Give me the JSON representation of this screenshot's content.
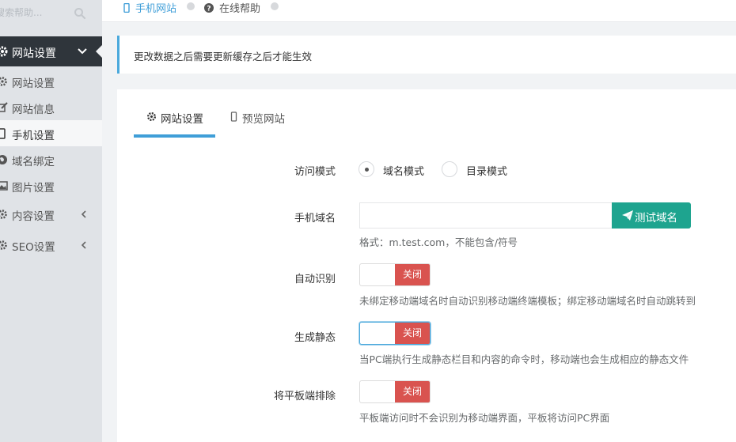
{
  "sidebar": {
    "search_placeholder": "搜索帮助...",
    "group_label": "网站设置",
    "items": [
      {
        "label": "网站设置",
        "icon": "gear-icon"
      },
      {
        "label": "网站信息",
        "icon": "edit-icon"
      },
      {
        "label": "手机设置",
        "icon": "mobile-icon"
      },
      {
        "label": "域名绑定",
        "icon": "globe-icon"
      },
      {
        "label": "图片设置",
        "icon": "image-icon"
      },
      {
        "label": "内容设置",
        "icon": "gear-icon"
      },
      {
        "label": "SEO设置",
        "icon": "gear-icon"
      }
    ]
  },
  "breadcrumb": [
    {
      "label": "手机网站",
      "icon": "mobile-icon"
    },
    {
      "label": "在线帮助",
      "icon": "help-icon"
    }
  ],
  "alert": {
    "text": "更改数据之后需要更新缓存之后才能生效"
  },
  "tabs": [
    {
      "label": "网站设置",
      "icon": "gear-icon"
    },
    {
      "label": "预览网站",
      "icon": "mobile-icon"
    }
  ],
  "form": {
    "access_mode": {
      "label": "访问模式",
      "options": [
        "域名模式",
        "目录模式"
      ],
      "selected": "域名模式"
    },
    "mobile_domain": {
      "label": "手机域名",
      "value": "",
      "button": "测试域名",
      "help": "格式：m.test.com，不能包含/符号"
    },
    "auto_detect": {
      "label": "自动识别",
      "state": "关闭",
      "help": "未绑定移动端域名时自动识别移动端终端模板；绑定移动端域名时自动跳转到"
    },
    "gen_static": {
      "label": "生成静态",
      "state": "关闭",
      "help": "当PC端执行生成静态栏目和内容的命令时，移动端也会生成相应的静态文件"
    },
    "tablet_exclude": {
      "label": "将平板端排除",
      "state": "关闭",
      "help": "平板端访问时不会识别为移动端界面，平板将访问PC界面"
    }
  },
  "colors": {
    "sidebar_bg": "#e0e3e7",
    "sidebar_active_bg": "#2f353b",
    "accent": "#3f9ed8",
    "button_green": "#1ea48f",
    "switch_off": "#d9534f"
  }
}
